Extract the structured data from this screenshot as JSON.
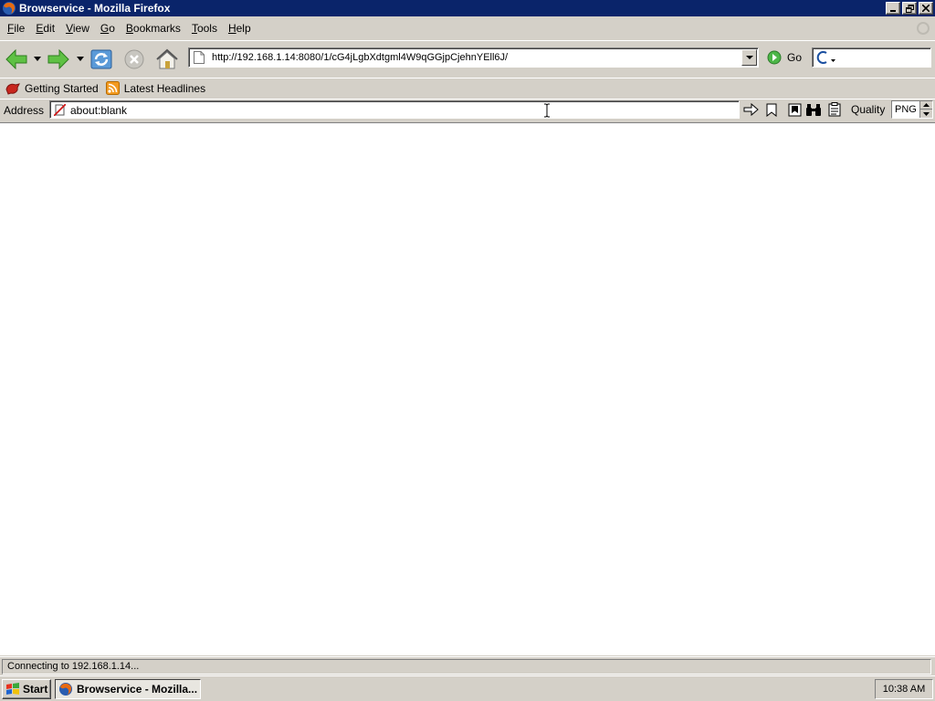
{
  "window": {
    "title": "Browservice - Mozilla Firefox",
    "controls": [
      "minimize-icon",
      "restore-icon",
      "close-icon"
    ]
  },
  "menu": {
    "items": [
      {
        "accel": "F",
        "rest": "ile"
      },
      {
        "accel": "E",
        "rest": "dit"
      },
      {
        "accel": "V",
        "rest": "iew"
      },
      {
        "accel": "G",
        "rest": "o"
      },
      {
        "accel": "B",
        "rest": "ookmarks"
      },
      {
        "accel": "T",
        "rest": "ools"
      },
      {
        "accel": "H",
        "rest": "elp"
      }
    ]
  },
  "navigation": {
    "url": "http://192.168.1.14:8080/1/cG4jLgbXdtgml4W9qGGjpCjehnYEll6J/",
    "go_label": "Go",
    "search_value": ""
  },
  "bookmarks": {
    "items": [
      {
        "label": "Getting Started",
        "icon": "getting-started-icon"
      },
      {
        "label": "Latest Headlines",
        "icon": "rss-feed-icon"
      }
    ]
  },
  "address_toolbar": {
    "label": "Address",
    "value": "about:blank",
    "quality_label": "Quality",
    "quality_value": "PNG"
  },
  "status": {
    "text": "Connecting to 192.168.1.14..."
  },
  "taskbar": {
    "start_label": "Start",
    "task_label": "Browservice - Mozilla...",
    "clock": "10:38 AM"
  },
  "colors": {
    "titlebar": "#0a246a",
    "chrome": "#d4d0c8",
    "content": "#ffffff"
  }
}
